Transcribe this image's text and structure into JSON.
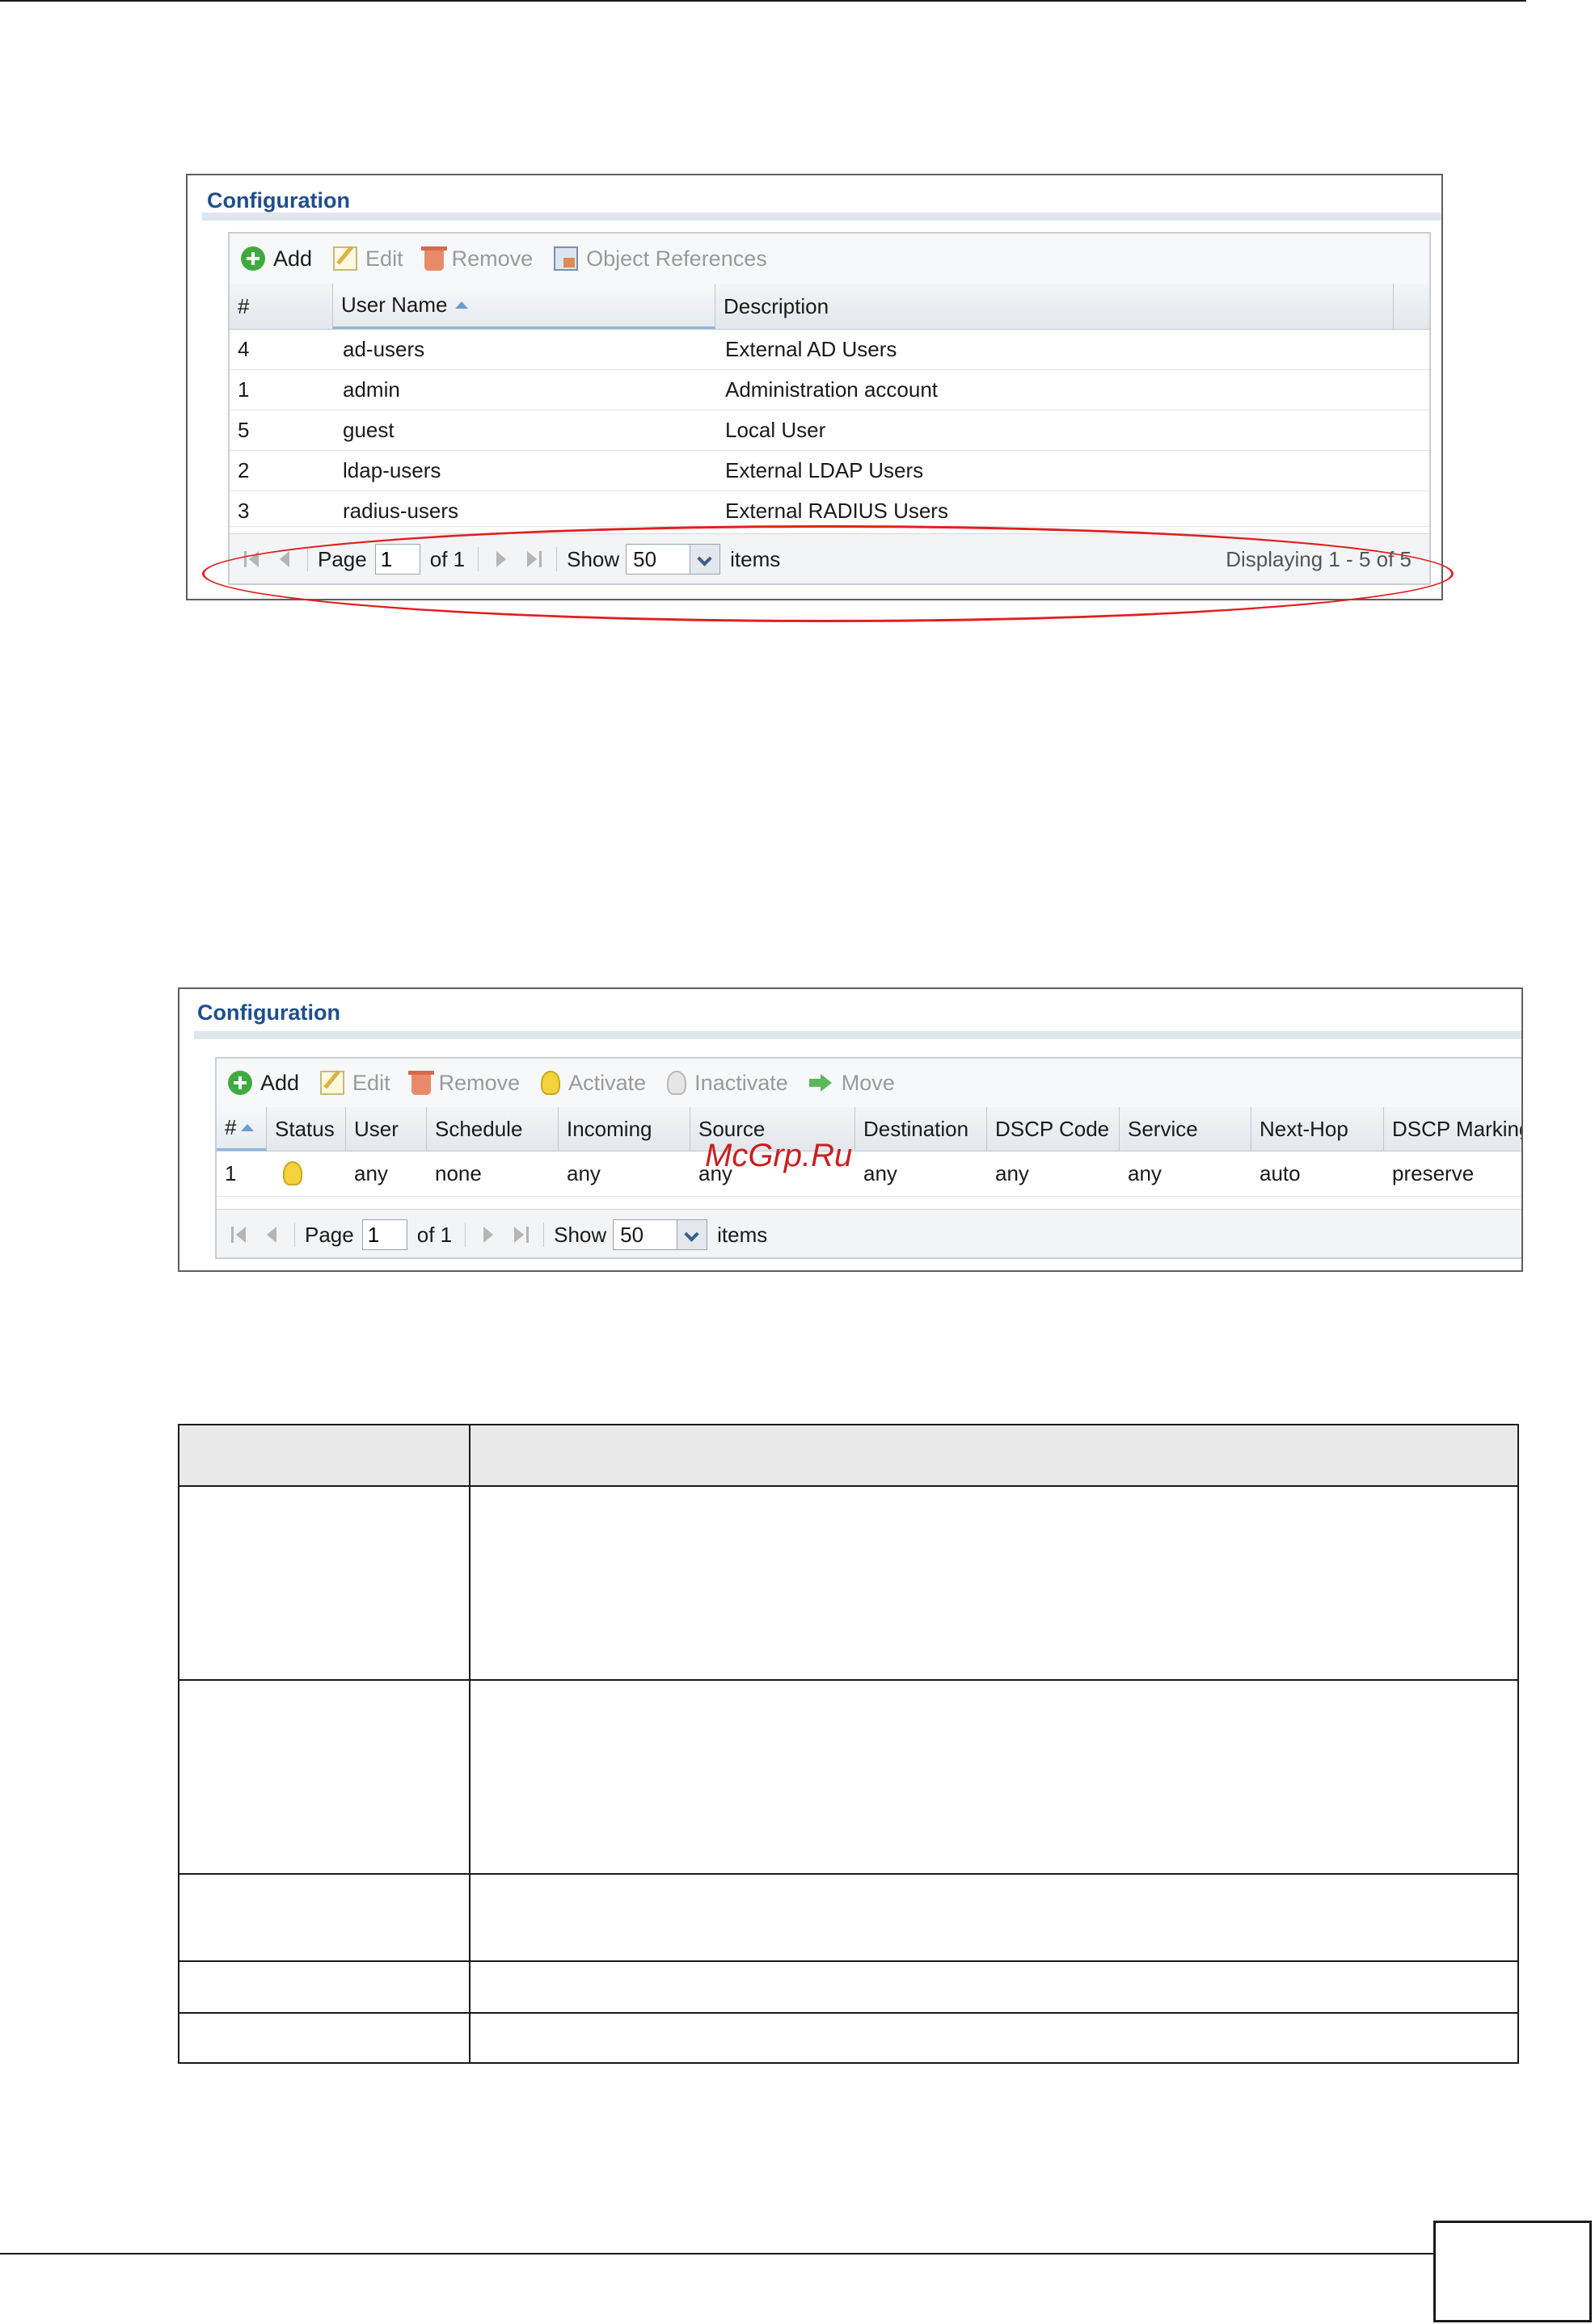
{
  "figure1": {
    "title": "Configuration",
    "toolbar": {
      "add": "Add",
      "edit": "Edit",
      "remove": "Remove",
      "object_references": "Object References"
    },
    "columns": {
      "num": "#",
      "user_name": "User Name",
      "description": "Description"
    },
    "rows": [
      {
        "num": "4",
        "user_name": "ad-users",
        "description": "External AD Users"
      },
      {
        "num": "1",
        "user_name": "admin",
        "description": "Administration account"
      },
      {
        "num": "5",
        "user_name": "guest",
        "description": "Local User"
      },
      {
        "num": "2",
        "user_name": "ldap-users",
        "description": "External LDAP Users"
      },
      {
        "num": "3",
        "user_name": "radius-users",
        "description": "External RADIUS Users"
      }
    ],
    "pager": {
      "page_label": "Page",
      "page_value": "1",
      "of_label": "of 1",
      "show_label": "Show",
      "show_value": "50",
      "items_label": "items",
      "displaying": "Displaying 1 - 5 of 5"
    }
  },
  "figure2": {
    "title": "Configuration",
    "toolbar": {
      "add": "Add",
      "edit": "Edit",
      "remove": "Remove",
      "activate": "Activate",
      "inactivate": "Inactivate",
      "move": "Move"
    },
    "columns": [
      "#",
      "Status",
      "User",
      "Schedule",
      "Incoming",
      "Source",
      "Destination",
      "DSCP Code",
      "Service",
      "Next-Hop",
      "DSCP Marking"
    ],
    "row": {
      "num": "1",
      "status_icon": "lightbulb-on-icon",
      "user": "any",
      "schedule": "none",
      "incoming": "any",
      "source": "any",
      "destination": "any",
      "dscp_code": "any",
      "service": "any",
      "next_hop": "auto",
      "dscp_marking": "preserve"
    },
    "pager": {
      "page_label": "Page",
      "page_value": "1",
      "of_label": "of 1",
      "show_label": "Show",
      "show_value": "50",
      "items_label": "items"
    }
  },
  "watermark": "McGrp.Ru",
  "colors": {
    "title_blue": "#1f4e8c",
    "highlight_red": "#e02020",
    "bulb_yellow": "#f4d23c",
    "add_green": "#3faa3f"
  }
}
